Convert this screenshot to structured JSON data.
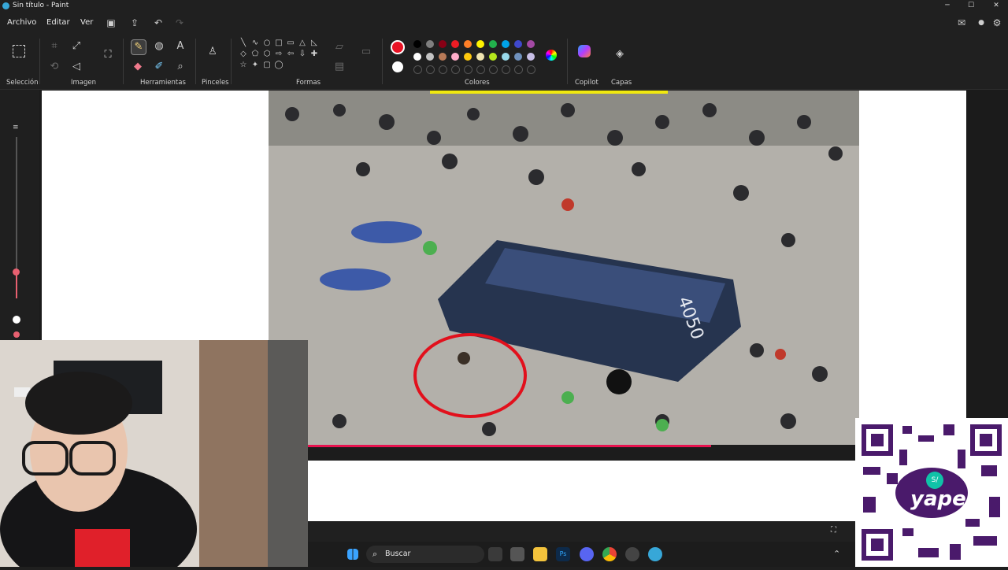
{
  "window": {
    "title": "Sin título - Paint",
    "minimize": "─",
    "maximize": "☐",
    "close": "✕"
  },
  "menu": {
    "items": [
      "Archivo",
      "Editar",
      "Ver"
    ]
  },
  "quick_actions": {
    "save_icon": "save-icon",
    "share_icon": "share-icon",
    "undo_icon": "undo-icon",
    "redo_icon": "redo-icon"
  },
  "ribbon": {
    "groups": [
      "Selección",
      "Imagen",
      "Herramientas",
      "Pinceles",
      "Formas",
      "Colores",
      "Copilot",
      "Capas"
    ],
    "shape_glyphs": [
      "╲",
      "∿",
      "○",
      "□",
      "▭",
      "△",
      "◺",
      "◇",
      "⬠",
      "⬡",
      "⇨",
      "⇦",
      "⇩",
      "✚",
      "☆",
      "✦",
      "▢",
      "◯"
    ],
    "active_color": "#e81224",
    "secondary_color": "#ffffff",
    "palette_row1": [
      "#000000",
      "#7f7f7f",
      "#880015",
      "#ed1c24",
      "#ff7f27",
      "#fff200",
      "#22b14c",
      "#00a2e8",
      "#3f48cc",
      "#a349a4"
    ],
    "palette_row2": [
      "#ffffff",
      "#c3c3c3",
      "#b97a57",
      "#ffaec9",
      "#ffc90e",
      "#efe4b0",
      "#b5e61d",
      "#99d9ea",
      "#7092be",
      "#c8bfe7"
    ]
  },
  "taskbar": {
    "search_placeholder": "Buscar",
    "tray_time": "",
    "tray_glyph": "⌃"
  },
  "overlay": {
    "qr_brand": "yape",
    "qr_badge": "S/"
  }
}
